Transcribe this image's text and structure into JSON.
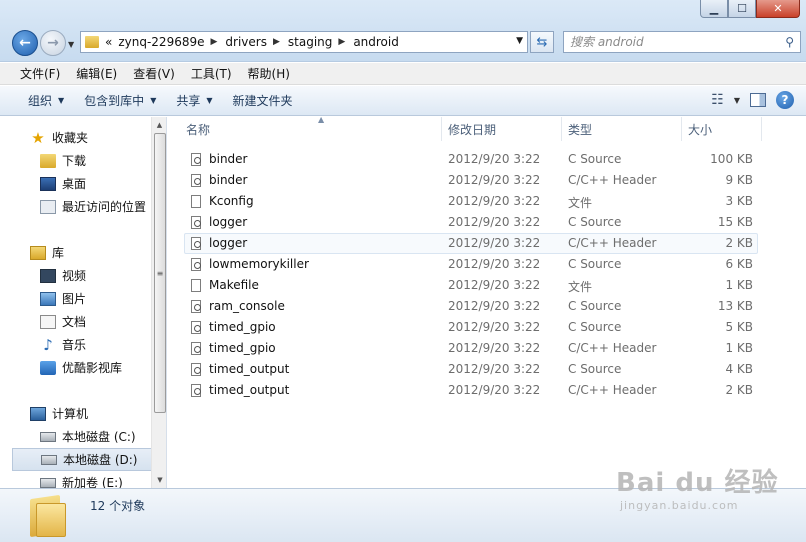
{
  "address": {
    "overflow": "«",
    "crumbs": [
      "zynq-229689e",
      "drivers",
      "staging",
      "android"
    ]
  },
  "search": {
    "placeholder": "搜索 android"
  },
  "menu": [
    "文件(F)",
    "编辑(E)",
    "查看(V)",
    "工具(T)",
    "帮助(H)"
  ],
  "commands": {
    "organize": "组织",
    "include_library": "包含到库中",
    "share": "共享",
    "new_folder": "新建文件夹"
  },
  "nav": {
    "favorites": "收藏夹",
    "downloads": "下载",
    "desktop": "桌面",
    "recent": "最近访问的位置",
    "libraries": "库",
    "videos": "视频",
    "pictures": "图片",
    "documents": "文档",
    "music": "音乐",
    "youku": "优酷影视库",
    "computer": "计算机",
    "disk_c": "本地磁盘 (C:)",
    "disk_d": "本地磁盘 (D:)",
    "disk_e": "新加卷 (E:)"
  },
  "columns": {
    "name": "名称",
    "date": "修改日期",
    "type": "类型",
    "size": "大小"
  },
  "files": [
    {
      "name": "binder",
      "date": "2012/9/20 3:22",
      "type": "C Source",
      "size": "100 KB"
    },
    {
      "name": "binder",
      "date": "2012/9/20 3:22",
      "type": "C/C++ Header",
      "size": "9 KB"
    },
    {
      "name": "Kconfig",
      "date": "2012/9/20 3:22",
      "type": "文件",
      "size": "3 KB"
    },
    {
      "name": "logger",
      "date": "2012/9/20 3:22",
      "type": "C Source",
      "size": "15 KB"
    },
    {
      "name": "logger",
      "date": "2012/9/20 3:22",
      "type": "C/C++ Header",
      "size": "2 KB"
    },
    {
      "name": "lowmemorykiller",
      "date": "2012/9/20 3:22",
      "type": "C Source",
      "size": "6 KB"
    },
    {
      "name": "Makefile",
      "date": "2012/9/20 3:22",
      "type": "文件",
      "size": "1 KB"
    },
    {
      "name": "ram_console",
      "date": "2012/9/20 3:22",
      "type": "C Source",
      "size": "13 KB"
    },
    {
      "name": "timed_gpio",
      "date": "2012/9/20 3:22",
      "type": "C Source",
      "size": "5 KB"
    },
    {
      "name": "timed_gpio",
      "date": "2012/9/20 3:22",
      "type": "C/C++ Header",
      "size": "1 KB"
    },
    {
      "name": "timed_output",
      "date": "2012/9/20 3:22",
      "type": "C Source",
      "size": "4 KB"
    },
    {
      "name": "timed_output",
      "date": "2012/9/20 3:22",
      "type": "C/C++ Header",
      "size": "2 KB"
    }
  ],
  "details": {
    "count": "12 个对象"
  },
  "watermark": {
    "logo": "Bai du 经验",
    "url": "jingyan.baidu.com"
  }
}
